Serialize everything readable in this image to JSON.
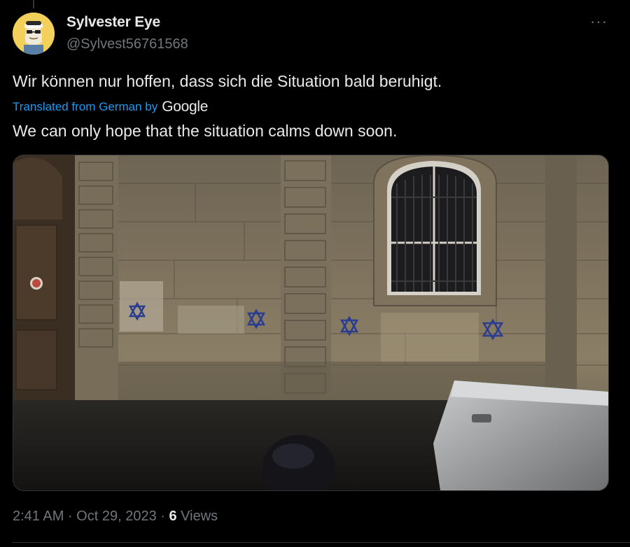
{
  "author": {
    "name": "Sylvester Eye",
    "handle": "@Sylvest56761568"
  },
  "more_label": "···",
  "tweet": {
    "text": "Wir können nur hoffen, dass sich die Situation bald beruhigt.",
    "translated_label": "Translated from German by",
    "translator": "Google",
    "translation": "We can only hope that the situation calms down soon."
  },
  "meta": {
    "time": "2:41 AM",
    "separator": " · ",
    "date": "Oct 29, 2023",
    "views_count": "6",
    "views_label": "Views"
  },
  "colors": {
    "background": "#000000",
    "text_primary": "#e7e9ea",
    "text_secondary": "#71767b",
    "link": "#1d9bf0",
    "star_paint": "#2b3d8f"
  },
  "icons": {
    "more": "more-horizontal-icon",
    "avatar": "avatar-illustration",
    "star": "star-of-david-graffiti"
  }
}
